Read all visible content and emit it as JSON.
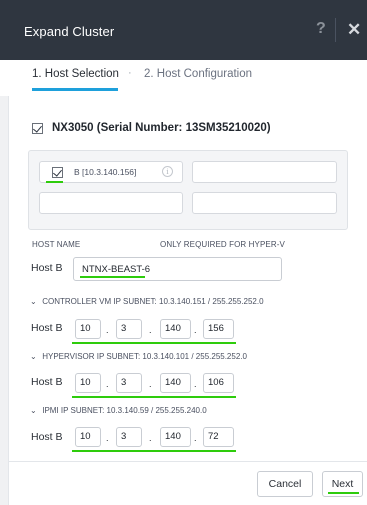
{
  "dialog": {
    "title": "Expand Cluster",
    "help_symbol": "?",
    "close_symbol": "✕"
  },
  "tabs": [
    {
      "label": "1. Host Selection"
    },
    {
      "label": "2. Host Configuration"
    }
  ],
  "tab_separator": "·",
  "node": {
    "title": "NX3050 (Serial Number: 13SM35210020)",
    "slot_label": "B [10.3.140.156]",
    "info_symbol": "i"
  },
  "host_name": {
    "column_label": "HOST NAME",
    "hyperv_note": "ONLY REQUIRED FOR HYPER-V",
    "row_label": "Host B",
    "value": "NTNX-BEAST-6"
  },
  "sections": [
    {
      "header": "CONTROLLER VM IP   SUBNET:  10.3.140.151 / 255.255.252.0",
      "row_label": "Host B",
      "octets": [
        "10",
        "3",
        "140",
        "156"
      ]
    },
    {
      "header": "HYPERVISOR IP   SUBNET:  10.3.140.101 / 255.255.252.0",
      "row_label": "Host B",
      "octets": [
        "10",
        "3",
        "140",
        "106"
      ]
    },
    {
      "header": "IPMI IP   SUBNET:  10.3.140.59 / 255.255.240.0",
      "row_label": "Host B",
      "octets": [
        "10",
        "3",
        "140",
        "72"
      ]
    }
  ],
  "octet_separator": ".",
  "chevron_symbol": "⌄",
  "buttons": {
    "cancel": "Cancel",
    "next": "Next"
  },
  "colors": {
    "titlebar": "#2f3640",
    "tab_accent": "#1ea0db",
    "highlight_underline": "#2ecc0c"
  },
  "icons": [
    "help-icon",
    "close-icon",
    "checkbox-checked-icon",
    "info-icon",
    "chevron-down-icon"
  ]
}
